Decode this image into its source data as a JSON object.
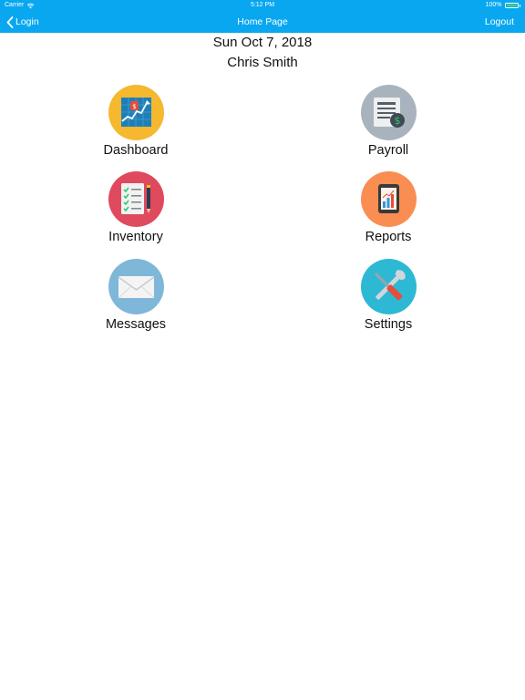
{
  "status_bar": {
    "carrier": "Carrier",
    "time": "5:12 PM",
    "battery": "100%"
  },
  "nav": {
    "back_label": "Login",
    "title": "Home Page",
    "logout_label": "Logout"
  },
  "header_info": {
    "date": "Sun Oct 7, 2018",
    "user": "Chris Smith"
  },
  "tiles": [
    {
      "label": "Dashboard",
      "icon": "dashboard-chart-icon",
      "color": "#F5B82E"
    },
    {
      "label": "Payroll",
      "icon": "payroll-document-icon",
      "color": "#A9B3BD"
    },
    {
      "label": "Inventory",
      "icon": "inventory-checklist-icon",
      "color": "#E04A5F"
    },
    {
      "label": "Reports",
      "icon": "reports-tablet-icon",
      "color": "#F98D52"
    },
    {
      "label": "Messages",
      "icon": "envelope-icon",
      "color": "#7FB7D9"
    },
    {
      "label": "Settings",
      "icon": "wrench-screwdriver-icon",
      "color": "#2DB8D4"
    }
  ],
  "colors": {
    "header": "#08A7F0",
    "battery": "#4CD964"
  }
}
